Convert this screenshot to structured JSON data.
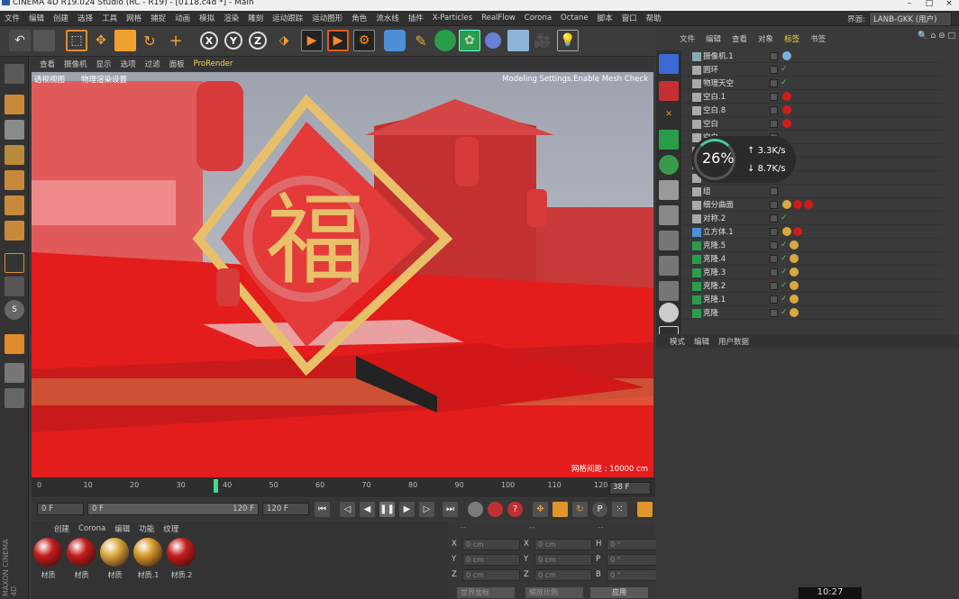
{
  "window": {
    "title": "CINEMA 4D R19.024 Studio (RC - R19) - [0118.c4d *] - Main"
  },
  "menubar": {
    "items": [
      "文件",
      "编辑",
      "创建",
      "选择",
      "工具",
      "网格",
      "捕捉",
      "动画",
      "模拟",
      "渲染",
      "雕刻",
      "运动跟踪",
      "运动图形",
      "角色",
      "流水线",
      "插件",
      "X-Particles",
      "RealFlow",
      "Corona",
      "Octane",
      "脚本",
      "窗口",
      "帮助"
    ]
  },
  "layout": {
    "label": "界面:",
    "value": "LANB-GKK (用户)"
  },
  "toolbar": {
    "icons": [
      "undo-icon",
      "redo-icon",
      "select-icon",
      "move-icon",
      "scale-icon",
      "rotate-icon",
      "live-select-icon",
      "axis-x",
      "axis-y",
      "axis-z",
      "coordinate-system-icon",
      "render-view-icon",
      "render-picture-icon",
      "render-settings-icon",
      "cube-icon",
      "pen-icon",
      "subdivision-icon",
      "cloner-icon",
      "deformer-icon",
      "floor-icon",
      "camera-icon",
      "light-icon"
    ],
    "axis_labels": [
      "X",
      "Y",
      "Z"
    ]
  },
  "viewport": {
    "menu": [
      "查看",
      "摄像机",
      "显示",
      "选项",
      "过滤",
      "面板",
      "ProRender"
    ],
    "label": "透视视图",
    "camera": "物理渲染设置",
    "top_right": "Modeling Settings.Enable Mesh Check",
    "grid_info": "网格间距 : 10000 cm",
    "fu_character": "福"
  },
  "timeline": {
    "ticks": [
      "0",
      "10",
      "20",
      "30",
      "40",
      "50",
      "60",
      "70",
      "80",
      "90",
      "100",
      "110",
      "120"
    ],
    "current_frame": "38 F",
    "playhead_frame": 38
  },
  "transport": {
    "start": "0 F",
    "min": "0 F",
    "max": "120 F",
    "end": "120 F"
  },
  "materials": {
    "menu": [
      "创建",
      "Corona",
      "编辑",
      "功能",
      "纹理"
    ],
    "items": [
      {
        "label": "材质",
        "color": "#c41d1d"
      },
      {
        "label": "材质",
        "color": "#c41d1d"
      },
      {
        "label": "材质",
        "color": "#d9a93e"
      },
      {
        "label": "材质.1",
        "color": "#d89a2a"
      },
      {
        "label": "材质.2",
        "color": "#c41d1d"
      }
    ]
  },
  "coords": {
    "headers": [
      "--",
      "--",
      "--"
    ],
    "rows": [
      {
        "a": "X",
        "av": "0 cm",
        "b": "X",
        "bv": "0 cm",
        "c": "H",
        "cv": "0 °"
      },
      {
        "a": "Y",
        "av": "0 cm",
        "b": "Y",
        "bv": "0 cm",
        "c": "P",
        "cv": "0 °"
      },
      {
        "a": "Z",
        "av": "0 cm",
        "b": "Z",
        "bv": "0 cm",
        "c": "B",
        "cv": "0 °"
      }
    ],
    "world": "世界坐标",
    "scale": "缩放比例",
    "apply": "应用"
  },
  "objects": {
    "menu": [
      "文件",
      "编辑",
      "查看",
      "对象",
      "标签",
      "书签"
    ],
    "rows": [
      {
        "name": "摄像机.1",
        "icon": "camera-icon",
        "check": false,
        "tags": [
          "#7ab0e0"
        ]
      },
      {
        "name": "圆环",
        "icon": "circle-icon",
        "check": true,
        "tags": []
      },
      {
        "name": "物理天空",
        "icon": "sky-icon",
        "check": true,
        "tags": []
      },
      {
        "name": "空白.1",
        "icon": "null-icon",
        "check": false,
        "tags": [
          "#d21b1b"
        ]
      },
      {
        "name": "空白.8",
        "icon": "null-icon",
        "check": false,
        "tags": [
          "#d21b1b"
        ]
      },
      {
        "name": "空白",
        "icon": "null-icon",
        "check": false,
        "tags": [
          "#d21b1b"
        ]
      },
      {
        "name": "空白",
        "icon": "null-icon",
        "check": false,
        "tags": []
      },
      {
        "name": "",
        "icon": "null-icon",
        "check": false,
        "tags": []
      },
      {
        "name": "",
        "icon": "null-icon",
        "check": false,
        "tags": [
          "#d21b1b"
        ]
      },
      {
        "name": "",
        "icon": "null-icon",
        "check": false,
        "tags": []
      },
      {
        "name": "组",
        "icon": "null-icon",
        "check": false,
        "tags": []
      },
      {
        "name": "细分曲面",
        "icon": "subdivision-icon",
        "check": false,
        "tags": [
          "#d9a93e",
          "#d21b1b",
          "#d21b1b"
        ]
      },
      {
        "name": "对称.2",
        "icon": "symmetry-icon",
        "check": true,
        "tags": []
      },
      {
        "name": "立方体.1",
        "icon": "cube-icon",
        "check": false,
        "tags": [
          "#d9a93e",
          "#d21b1b"
        ]
      },
      {
        "name": "克隆.5",
        "icon": "cloner-icon",
        "check": true,
        "tags": [
          "#d9a93e"
        ]
      },
      {
        "name": "克隆.4",
        "icon": "cloner-icon",
        "check": true,
        "tags": [
          "#d9a93e"
        ]
      },
      {
        "name": "克隆.3",
        "icon": "cloner-icon",
        "check": true,
        "tags": [
          "#d9a93e"
        ]
      },
      {
        "name": "克隆.2",
        "icon": "cloner-icon",
        "check": true,
        "tags": [
          "#d9a93e"
        ]
      },
      {
        "name": "克隆.1",
        "icon": "cloner-icon",
        "check": true,
        "tags": [
          "#d9a93e"
        ]
      },
      {
        "name": "克隆",
        "icon": "cloner-icon",
        "check": true,
        "tags": [
          "#d9a93e"
        ]
      }
    ]
  },
  "attributes": {
    "menu": [
      "模式",
      "编辑",
      "用户数据"
    ]
  },
  "netmon": {
    "percent": "26%",
    "up": "3.3K/s",
    "down": "8.7K/s"
  },
  "clock": "10:27",
  "brand": "MAXON CINEMA 4D"
}
